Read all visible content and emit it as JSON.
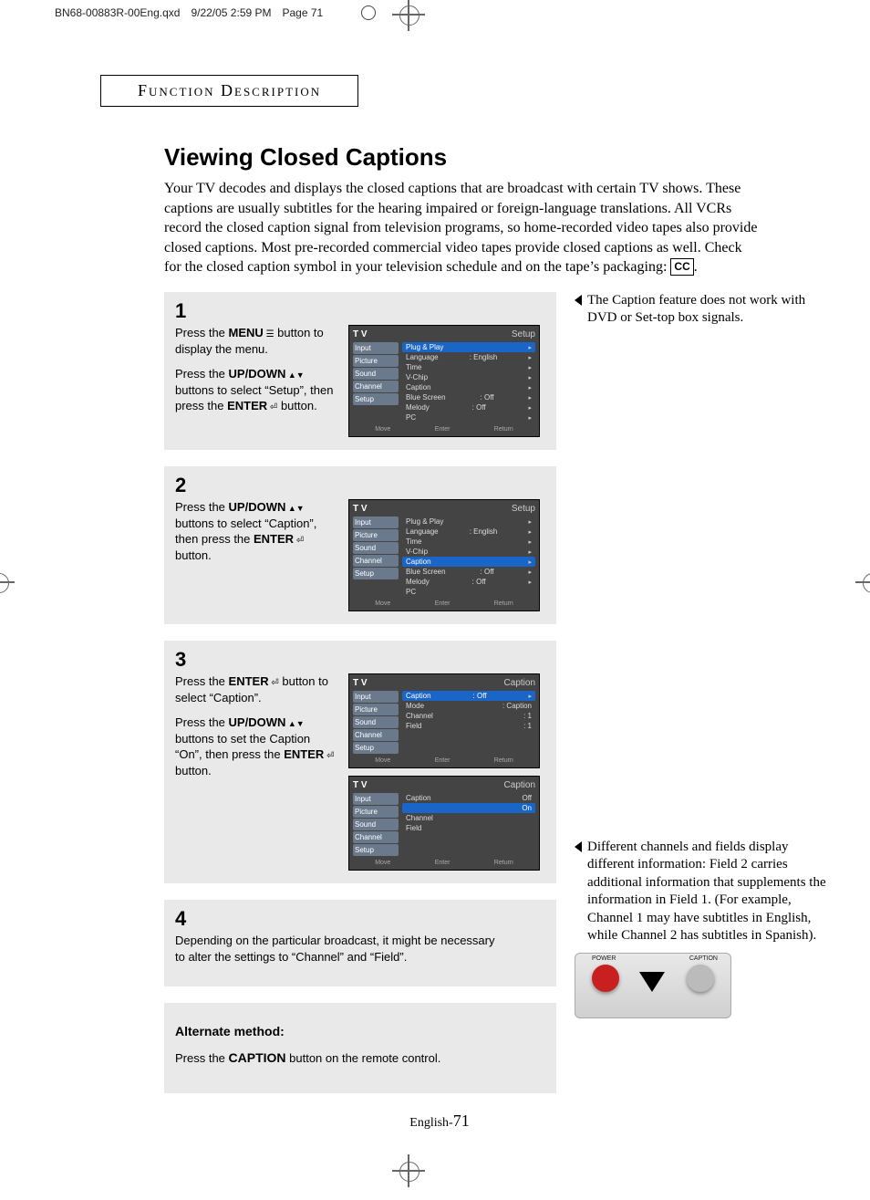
{
  "print_header": {
    "filename": "BN68-00883R-00Eng.qxd",
    "timestamp": "9/22/05  2:59 PM",
    "page_label": "Page 71"
  },
  "section_heading": "Function Description",
  "title": "Viewing Closed Captions",
  "intro_text": "Your TV decodes and displays the closed captions that are broadcast with certain TV shows. These captions are usually subtitles for the hearing impaired or foreign-language translations. All VCRs record the closed caption signal from television programs, so home-recorded video tapes also provide closed captions. Most pre-recorded commercial video tapes provide closed captions as well. Check for the closed caption symbol in your television schedule and on the tape’s packaging: ",
  "cc_symbol": "CC",
  "intro_tail": ".",
  "steps": {
    "s1": {
      "num": "1",
      "p1a": "Press the ",
      "p1b_bold": "MENU",
      "p1c": " button to display the menu.",
      "p2a": "Press the ",
      "p2b_bold": "UP/DOWN",
      "p2c": " buttons to select “Setup”, then press the ",
      "p2d_bold": "ENTER",
      "p2e": " button."
    },
    "s2": {
      "num": "2",
      "p1a": "Press the ",
      "p1b_bold": "UP/DOWN",
      "p1c": " buttons to select “Caption”, then press the ",
      "p1d_bold": "ENTER",
      "p1e": " button."
    },
    "s3": {
      "num": "3",
      "p1a": "Press the ",
      "p1b_bold": "ENTER",
      "p1c": " button to select “Caption”.",
      "p2a": "Press the ",
      "p2b_bold": "UP/DOWN",
      "p2c": " buttons to set the Caption “On”, then press the ",
      "p2d_bold": "ENTER",
      "p2e": " button."
    },
    "s4": {
      "num": "4",
      "p1": "Depending on the particular broadcast, it might be necessary to alter the settings to “Channel” and “Field”."
    }
  },
  "alt": {
    "heading": "Alternate method:",
    "line_a": "Press the ",
    "line_bold": "CAPTION",
    "line_b": " button on the remote control."
  },
  "side_note_top": "The Caption feature does not work with DVD or Set-top box signals.",
  "side_note_bottom": "Different channels and fields display different information: Field 2 carries additional information that supplements the information in Field 1. (For example, Channel 1 may have subtitles in English, while Channel 2 has subtitles in Spanish).",
  "tv_common": {
    "tv_label": "T V",
    "tabs": [
      "Input",
      "Picture",
      "Sound",
      "Channel",
      "Setup"
    ],
    "foot_move": "Move",
    "foot_enter": "Enter",
    "foot_return": "Return"
  },
  "tv1": {
    "title": "Setup",
    "rows": [
      {
        "k": "Plug & Play",
        "v": "",
        "hl": true
      },
      {
        "k": "Language",
        "v": ": English"
      },
      {
        "k": "Time",
        "v": ""
      },
      {
        "k": "V-Chip",
        "v": ""
      },
      {
        "k": "Caption",
        "v": ""
      },
      {
        "k": "Blue Screen",
        "v": ": Off"
      },
      {
        "k": "Melody",
        "v": ": Off"
      },
      {
        "k": "PC",
        "v": ""
      }
    ]
  },
  "tv2": {
    "title": "Setup",
    "rows": [
      {
        "k": "Plug & Play",
        "v": ""
      },
      {
        "k": "Language",
        "v": ": English"
      },
      {
        "k": "Time",
        "v": ""
      },
      {
        "k": "V-Chip",
        "v": ""
      },
      {
        "k": "Caption",
        "v": "",
        "hl": true
      },
      {
        "k": "Blue Screen",
        "v": ": Off"
      },
      {
        "k": "Melody",
        "v": ": Off"
      },
      {
        "k": "PC",
        "v": ""
      }
    ]
  },
  "tv3a": {
    "title": "Caption",
    "rows": [
      {
        "k": "Caption",
        "v": ": Off",
        "hl": true
      },
      {
        "k": "Mode",
        "v": ": Caption"
      },
      {
        "k": "Channel",
        "v": ": 1"
      },
      {
        "k": "Field",
        "v": ": 1"
      }
    ]
  },
  "tv3b": {
    "title": "Caption",
    "rows": [
      {
        "k": "Caption",
        "v": "Off"
      },
      {
        "k": "",
        "v": "On",
        "hl": true
      },
      {
        "k": "Channel",
        "v": ""
      },
      {
        "k": "Field",
        "v": ""
      }
    ]
  },
  "remote": {
    "power": "POWER",
    "caption": "CAPTION"
  },
  "footer_pre": "English-",
  "footer_num": "71"
}
